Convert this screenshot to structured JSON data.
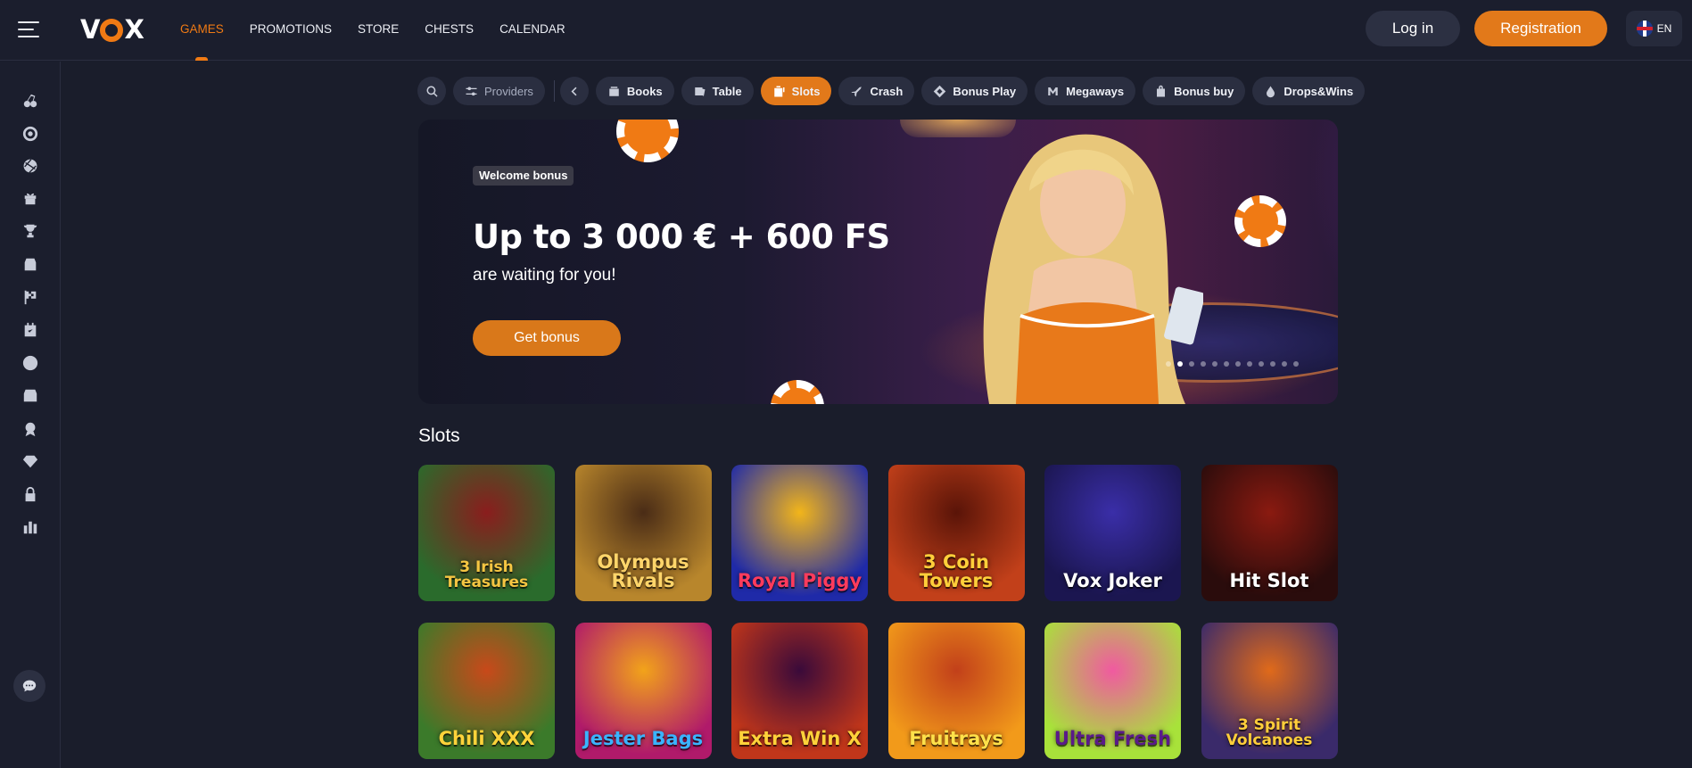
{
  "header": {
    "logo_left": "V",
    "logo_right": "X",
    "nav": [
      "GAMES",
      "PROMOTIONS",
      "STORE",
      "CHESTS",
      "CALENDAR"
    ],
    "active_nav": "GAMES",
    "login_label": "Log in",
    "register_label": "Registration",
    "language": "EN"
  },
  "rail": {
    "icons": [
      "cherries-icon",
      "roulette-icon",
      "sports-ball-icon",
      "gift-icon",
      "trophy-icon",
      "store-icon",
      "race-flag-icon",
      "calendar-icon",
      "wheel-icon",
      "chest-icon",
      "badge-icon",
      "diamond-icon",
      "lock-icon",
      "leaderboard-icon"
    ],
    "chat_icon": "chat-icon"
  },
  "categories": {
    "providers_label": "Providers",
    "items": [
      {
        "label": "Books",
        "icon": "books-icon",
        "active": false
      },
      {
        "label": "Table",
        "icon": "table-icon",
        "active": false
      },
      {
        "label": "Slots",
        "icon": "slots-icon",
        "active": true
      },
      {
        "label": "Crash",
        "icon": "plane-icon",
        "active": false
      },
      {
        "label": "Bonus Play",
        "icon": "diamond-icon",
        "active": false
      },
      {
        "label": "Megaways",
        "icon": "megaways-icon",
        "active": false
      },
      {
        "label": "Bonus buy",
        "icon": "bag-icon",
        "active": false
      },
      {
        "label": "Drops&Wins",
        "icon": "drop-icon",
        "active": false
      }
    ]
  },
  "banner": {
    "tag": "Welcome bonus",
    "title": "Up to 3 000 € + 600 FS",
    "subtitle": "are waiting for you!",
    "cta": "Get bonus",
    "slides_total": 12,
    "active_slide": 2
  },
  "slots": {
    "title": "Slots",
    "games": [
      {
        "name": "3 Irish Treasures",
        "bg1": "#2a6b2c",
        "bg2": "#8a1d1d",
        "text_color": "#f5c542"
      },
      {
        "name": "Olympus Rivals",
        "bg1": "#b8862c",
        "bg2": "#4a2c16",
        "text_color": "#ffd56a"
      },
      {
        "name": "Royal Piggy",
        "bg1": "#1f2aa8",
        "bg2": "#f2b51a",
        "text_color": "#ff3b5c"
      },
      {
        "name": "3 Coin Towers",
        "bg1": "#c2401a",
        "bg2": "#5a1408",
        "text_color": "#ffcf3a"
      },
      {
        "name": "Vox Joker",
        "bg1": "#1b1650",
        "bg2": "#3a2ea8",
        "text_color": "#ffffff"
      },
      {
        "name": "Hit Slot",
        "bg1": "#2a0c0c",
        "bg2": "#8a1a10",
        "text_color": "#ffffff"
      },
      {
        "name": "Chili XXX",
        "bg1": "#3b7a2a",
        "bg2": "#c8491a",
        "text_color": "#ffd33a"
      },
      {
        "name": "Jester Bags",
        "bg1": "#b01a6a",
        "bg2": "#f2a31a",
        "text_color": "#3ab4ff"
      },
      {
        "name": "Extra Win X",
        "bg1": "#c1361a",
        "bg2": "#3a0a3a",
        "text_color": "#ffd23a"
      },
      {
        "name": "Fruitrays",
        "bg1": "#f29a1a",
        "bg2": "#c2401a",
        "text_color": "#ffe14a"
      },
      {
        "name": "Ultra Fresh",
        "bg1": "#a8e23a",
        "bg2": "#f05aa0",
        "text_color": "#5a1a8a"
      },
      {
        "name": "3 Spirit Volcanoes",
        "bg1": "#3a2a6a",
        "bg2": "#e06a1a",
        "text_color": "#ffce3a"
      }
    ]
  },
  "colors": {
    "accent": "#e2791a",
    "background": "#1a1d2b",
    "panel": "#2a2e40"
  }
}
